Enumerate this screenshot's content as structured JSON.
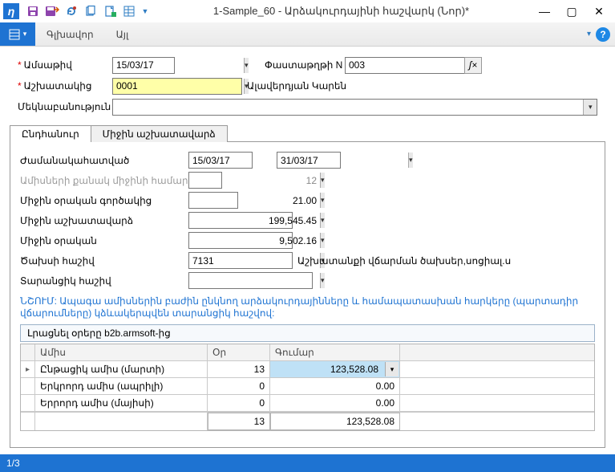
{
  "window": {
    "title": "1-Sample_60 - Արձակուրդայինի հաշվարկ (Նոր)*"
  },
  "menu": {
    "main": "Գլխավոր",
    "other": "Այլ"
  },
  "form": {
    "date_label": "Ամսաթիվ",
    "date_value": "15/03/17",
    "docnum_label": "Փաստաթղթի N",
    "docnum_value": "003",
    "employee_label": "Աշխատակից",
    "employee_code": "0001",
    "employee_name": "Ալավերդյան Կարեն",
    "comment_label": "Մեկնաբանություն",
    "comment_value": ""
  },
  "tabs": {
    "general": "Ընդհանուր",
    "salary": "Միջին աշխատավարձ"
  },
  "general": {
    "period_label": "Ժամանակահատված",
    "period_from": "15/03/17",
    "period_to": "31/03/17",
    "months_label": "Ամիսների քանակ միջինի համար",
    "months_value": "12",
    "avg_daily_coef_label": "Միջին օրական գործակից",
    "avg_daily_coef_value": "21.00",
    "avg_salary_label": "Միջին աշխատավարձ",
    "avg_salary_value": "199,545.45",
    "avg_daily_label": "Միջին օրական",
    "avg_daily_value": "9,502.16",
    "cost_account_label": "Ծախսի հաշիվ",
    "cost_account_value": "7131",
    "cost_account_desc": "Աշխատանքի վճարման ծախսեր,սոցիալ.ս",
    "transit_label": "Տարանցիկ հաշիվ",
    "transit_value": "",
    "note": "ՆՇՈՒՄ: Ապագա ամիսներին բաժին ընկնող արձակուրդայինները և համապատասխան հարկերը (պարտադիր վճարումները) կձևակերպվեն տարանցիկ հաշվով:",
    "fill_btn": "Լրացնել օրերը b2b.armsoft-ից"
  },
  "grid": {
    "headers": {
      "month": "Ամիս",
      "days": "Օր",
      "amount": "Գումար"
    },
    "rows": [
      {
        "month": "Ընթացիկ ամիս (մարտի)",
        "days": "13",
        "amount": "123,528.08"
      },
      {
        "month": "Երկրորդ ամիս (ապրիլի)",
        "days": "0",
        "amount": "0.00"
      },
      {
        "month": "Երրորդ ամիս (մայիսի)",
        "days": "0",
        "amount": "0.00"
      }
    ],
    "totals": {
      "days": "13",
      "amount": "123,528.08"
    }
  },
  "status": {
    "page": "1/3"
  }
}
